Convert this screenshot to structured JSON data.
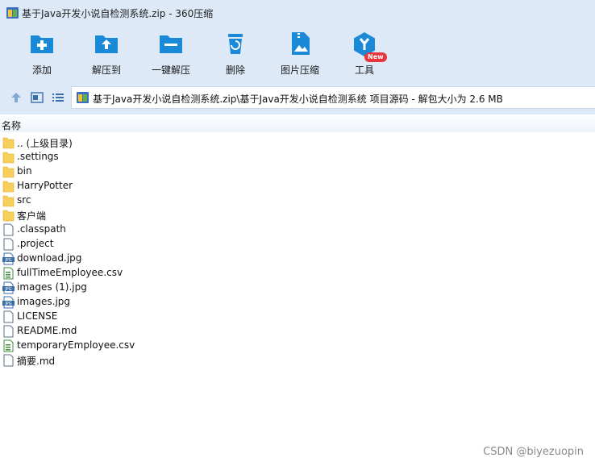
{
  "window": {
    "title": "基于Java开发小说自检测系统.zip - 360压缩",
    "icon": "archive-icon"
  },
  "toolbar": {
    "items": [
      {
        "label": "添加",
        "icon": "add-folder-icon"
      },
      {
        "label": "解压到",
        "icon": "extract-to-icon"
      },
      {
        "label": "一键解压",
        "icon": "one-click-extract-icon"
      },
      {
        "label": "删除",
        "icon": "trash-icon"
      },
      {
        "label": "图片压缩",
        "icon": "image-compress-icon"
      },
      {
        "label": "工具",
        "icon": "tools-icon"
      }
    ],
    "badge": "New"
  },
  "address": {
    "path": "基于Java开发小说自检测系统.zip\\基于Java开发小说自检测系统 项目源码 - 解包大小为 2.6 MB"
  },
  "columns": {
    "name": "名称"
  },
  "files": [
    {
      "name": ".. (上级目录)",
      "type": "folder"
    },
    {
      "name": ".settings",
      "type": "folder"
    },
    {
      "name": "bin",
      "type": "folder"
    },
    {
      "name": "HarryPotter",
      "type": "folder"
    },
    {
      "name": "src",
      "type": "folder"
    },
    {
      "name": "客户端",
      "type": "folder"
    },
    {
      "name": ".classpath",
      "type": "file"
    },
    {
      "name": ".project",
      "type": "file"
    },
    {
      "name": "download.jpg",
      "type": "jpg"
    },
    {
      "name": "fullTimeEmployee.csv",
      "type": "csv"
    },
    {
      "name": "images (1).jpg",
      "type": "jpg"
    },
    {
      "name": "images.jpg",
      "type": "jpg"
    },
    {
      "name": "LICENSE",
      "type": "file"
    },
    {
      "name": "README.md",
      "type": "file"
    },
    {
      "name": "temporaryEmployee.csv",
      "type": "csv"
    },
    {
      "name": "摘要.md",
      "type": "file"
    }
  ],
  "watermark": "CSDN @biyezuopin",
  "colors": {
    "toolbar_bg": "#dde9f7",
    "icon_blue": "#1a8ad8",
    "folder": "#f7cf5a",
    "badge": "#e8343a"
  }
}
